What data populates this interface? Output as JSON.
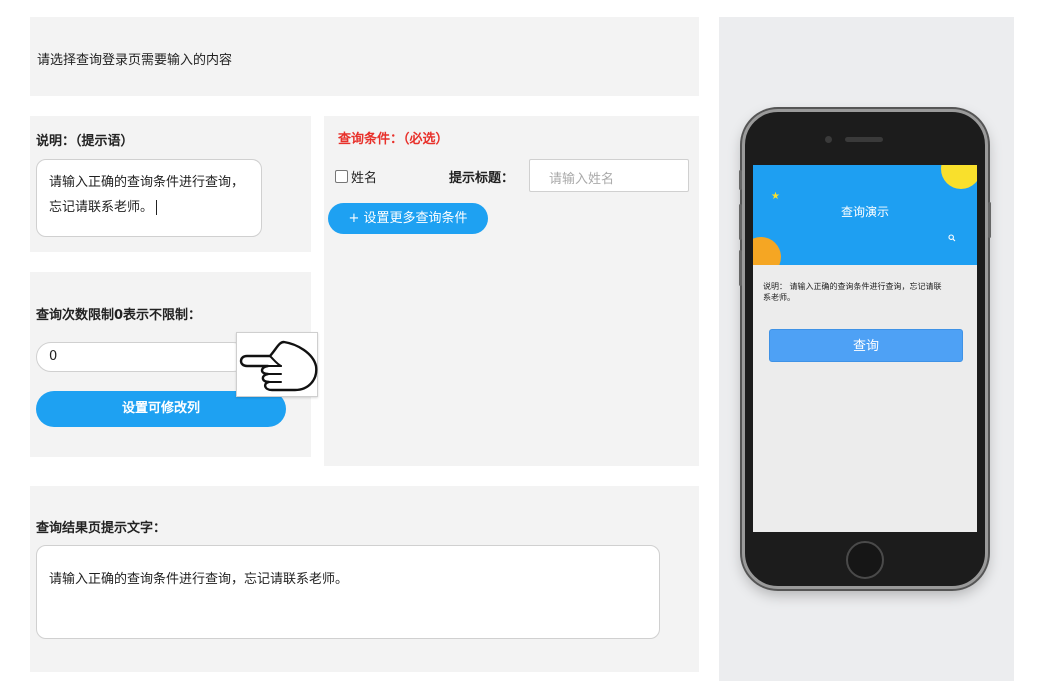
{
  "header": {
    "text": "请选择查询登录页需要输入的内容"
  },
  "description": {
    "heading": "说明：（提示语）",
    "text": "请输入正确的查询条件进行查询，忘记请联系老师。"
  },
  "limit": {
    "heading": "查询次数限制0表示不限制：",
    "value": "0",
    "button_label": "设置可修改列"
  },
  "conditions": {
    "heading": "查询条件：（必选）",
    "checkbox_label": "姓名",
    "checkbox_checked": false,
    "title_label": "提示标题：",
    "title_placeholder": "请输入姓名",
    "add_button_label": "+ 设置更多查询条件"
  },
  "result": {
    "heading": "查询结果页提示文字：",
    "text": "请输入正确的查询条件进行查询，忘记请联系老师。"
  },
  "phone": {
    "title": "查询演示",
    "description": "说明： 请输入正确的查询条件进行查询，忘记请联系老师。",
    "query_button": "查询"
  },
  "colors": {
    "accent": "#1ea1f2",
    "required": "#e8312b",
    "phone_banner": "#1e9ff2",
    "phone_button": "#4ea1f5",
    "sun": "#f9e02c",
    "orange": "#f5a623"
  },
  "icons": {
    "cursor": "hand-pointer-icon",
    "star": "star-icon",
    "search": "search-icon"
  }
}
